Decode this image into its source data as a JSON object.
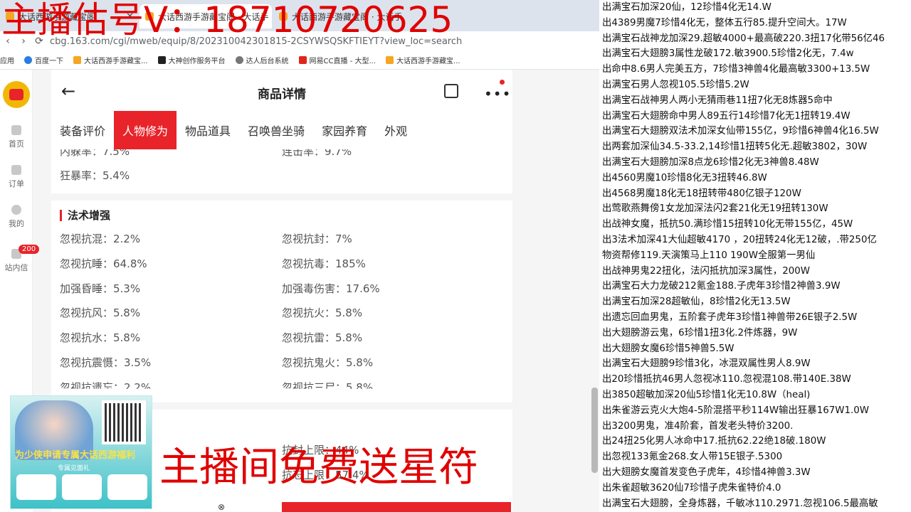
{
  "browser": {
    "tabs": [
      "大话西游手游藏宝阁",
      "大话西游手游藏宝阁 · 大话手",
      "大话西游手游藏宝阁 · 大话手"
    ],
    "url": "cbg.163.com/cgi/mweb/equip/8/202310042301815-2CSYWSQSKFTIEYT?view_loc=search",
    "bookmarks": [
      "应用",
      "百度一下",
      "大话西游手游藏宝...",
      "大神创作服务平台",
      "达人后台系统",
      "网易CC直播 - 大型...",
      "大话西游手游藏宝..."
    ]
  },
  "sidebar": {
    "items": [
      "首页",
      "订单",
      "我的",
      "站内信"
    ],
    "badge": "200"
  },
  "detail": {
    "title": "商品详情",
    "tabs": [
      "装备评价",
      "人物修为",
      "物品道具",
      "召唤兽坐骑",
      "家园养育",
      "外观"
    ],
    "partial": [
      "内躲率：7.5%",
      "连击率：9.7%",
      "狂暴率：5.4%"
    ],
    "section": "法术增强",
    "stats": [
      [
        "忽视抗混：2.2%",
        "忽视抗封：7%"
      ],
      [
        "忽视抗睡：64.8%",
        "忽视抗毒：185%"
      ],
      [
        "加强昏睡：5.3%",
        "加强毒伤害：17.6%"
      ],
      [
        "忽视抗风：5.8%",
        "忽视抗火：5.8%"
      ],
      [
        "忽视抗水：5.8%",
        "忽视抗雷：5.8%"
      ],
      [
        "忽视抗震慑：3.5%",
        "忽视抗鬼火：5.8%"
      ],
      [
        "忽视抗遗忘：2.2%",
        "忽视抗三尸：5.8%"
      ]
    ],
    "lower": [
      "抗封上限：44%",
      "抗忘上限：57.4%"
    ]
  },
  "listings": [
    "出满宝石加深20仙，12珍惜4化无14.W",
    "出4389男魔7珍惜4化无，整体五行85.提升空间大。17W",
    "出满宝石战神龙加深29.超敏4000+最高破220.3扭17化带56亿46",
    "出满宝石大翅膀3属性龙破172.敏3900.5珍惜2化无，7.4w",
    "出命中8.6男人完美五方，7珍惜3神兽4化最高敏3300+13.5W",
    "出满宝石男人忽视105.5珍惜5.2W",
    "出满宝石战神男人两小无猜雨巷11扭7化无8炼器5命中",
    "出满宝石大翅膀命中男人89五行14珍惜7化无1扭转19.4W",
    "出满宝石大翅膀双法术加深女仙带155亿，9珍惜6神兽4化16.5W",
    "出两套加深仙34.5-33.2,14珍惜1扭转5化无.超敏3802，30W",
    "出满宝石大翅膀加深8点龙6珍惜2化无3神兽8.48W",
    "出4560男魔10珍惜8化无3扭转46.8W",
    "出4568男魔18化无18扭转带480亿银子120W",
    "出莺歌燕舞傍1女龙加深法闪2套21化无19扭转130W",
    "出战神女魔，抵抗50.满珍惜15扭转10化无带155亿，45W",
    "出3法术加深41大仙超敏4170 ，20扭转24化无12破，.带250亿",
    "物资帮修119.天演策马上110 190W全服第一男仙",
    "出战神男鬼22扭化，法闪抵抗加深3属性，200W",
    "出满宝石大力龙破212氪金188.子虎年3珍惜2神兽3.9W",
    "出满宝石加深28超敏仙，8珍惜2化无13.5W",
    "出遗忘回血男鬼，五阶套子虎年3珍惜1神兽带26E银子2.5W",
    "出大翅膀游云鬼，6珍惜1扭3化.2件炼器，9W",
    "出大翅膀女魔6珍惜5神兽5.5W",
    "出满宝石大翅膀9珍惜3化，冰混双属性男人8.9W",
    "出20珍惜抵抗46男人忽视冰110.忽视混108.带140E.38W",
    "出3850超敏加深20仙5珍惜1化无10.8W（heal)",
    "出朱雀游云克火大炮4-5阶混搭平秒114W输出狂暴167W1.0W",
    "出3200男鬼，准4阶套，首发老头特价3200.",
    "出24扭25化男人冰命中17.抵抗62.22绝18破.180W",
    "出忽视133氪金268.女人带15E银子.5300",
    "出大翅膀女魔首发变色子虎年，4珍惜4神兽3.3W",
    "出朱雀超敏3620仙7珍惜子虎朱雀特价4.0",
    "出满宝石大翅膀，全身炼器，千敏冰110.2971.忽视106.5最高敏"
  ],
  "promo": {
    "headline": "为少侠申请专属大话西游福利",
    "sub": "专属见面礼"
  },
  "overlay": {
    "top": "主播估号V：18710720625",
    "bottom": "主播间免费送星符"
  },
  "colors": {
    "accent": "#e8232a",
    "watermark": "#e00000"
  }
}
